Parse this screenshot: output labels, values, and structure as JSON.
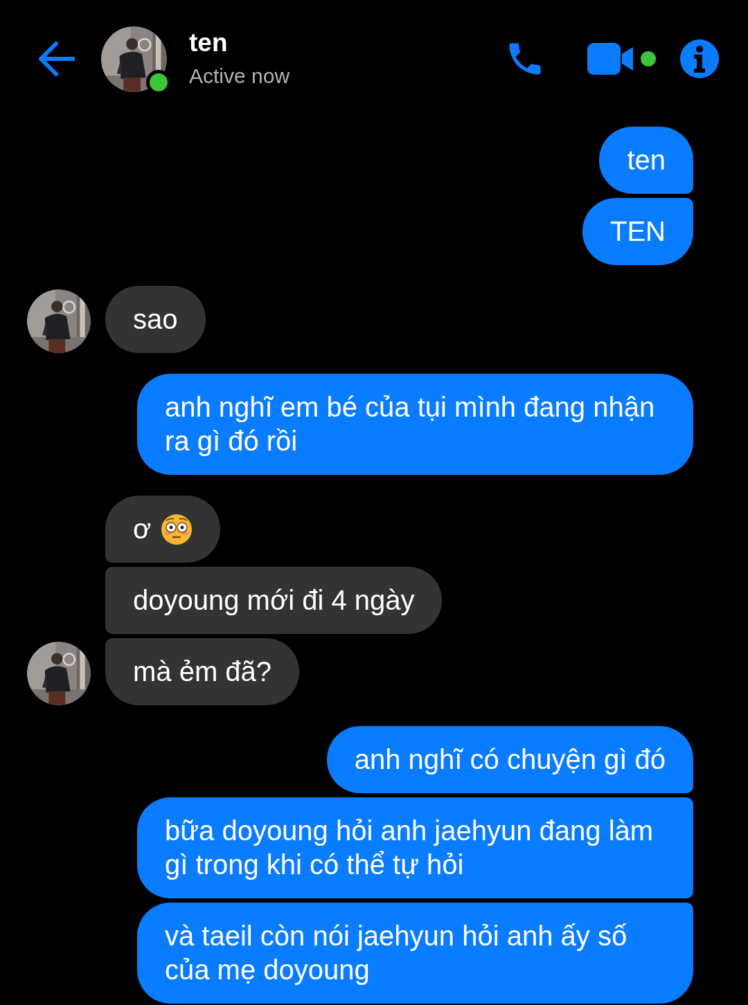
{
  "header": {
    "name": "ten",
    "status": "Active now",
    "online": true
  },
  "messages": [
    {
      "kind": "sent",
      "text": "ten"
    },
    {
      "kind": "sent",
      "text": "TEN"
    },
    {
      "kind": "received",
      "text": "sao"
    },
    {
      "kind": "sent",
      "text": "anh nghĩ em bé của tụi mình đang nhận ra gì đó rồi"
    },
    {
      "kind": "received",
      "text": "ơ",
      "emoji": true
    },
    {
      "kind": "received",
      "text": "doyoung mới đi 4 ngày"
    },
    {
      "kind": "received",
      "text": "mà ẻm đã?"
    },
    {
      "kind": "sent",
      "text": "anh nghĩ có chuyện gì đó"
    },
    {
      "kind": "sent",
      "text": "bữa doyoung hỏi anh jaehyun đang làm gì trong khi có thể tự hỏi"
    },
    {
      "kind": "sent",
      "text": "và taeil còn nói jaehyun hỏi anh ấy số của mẹ doyoung"
    }
  ]
}
